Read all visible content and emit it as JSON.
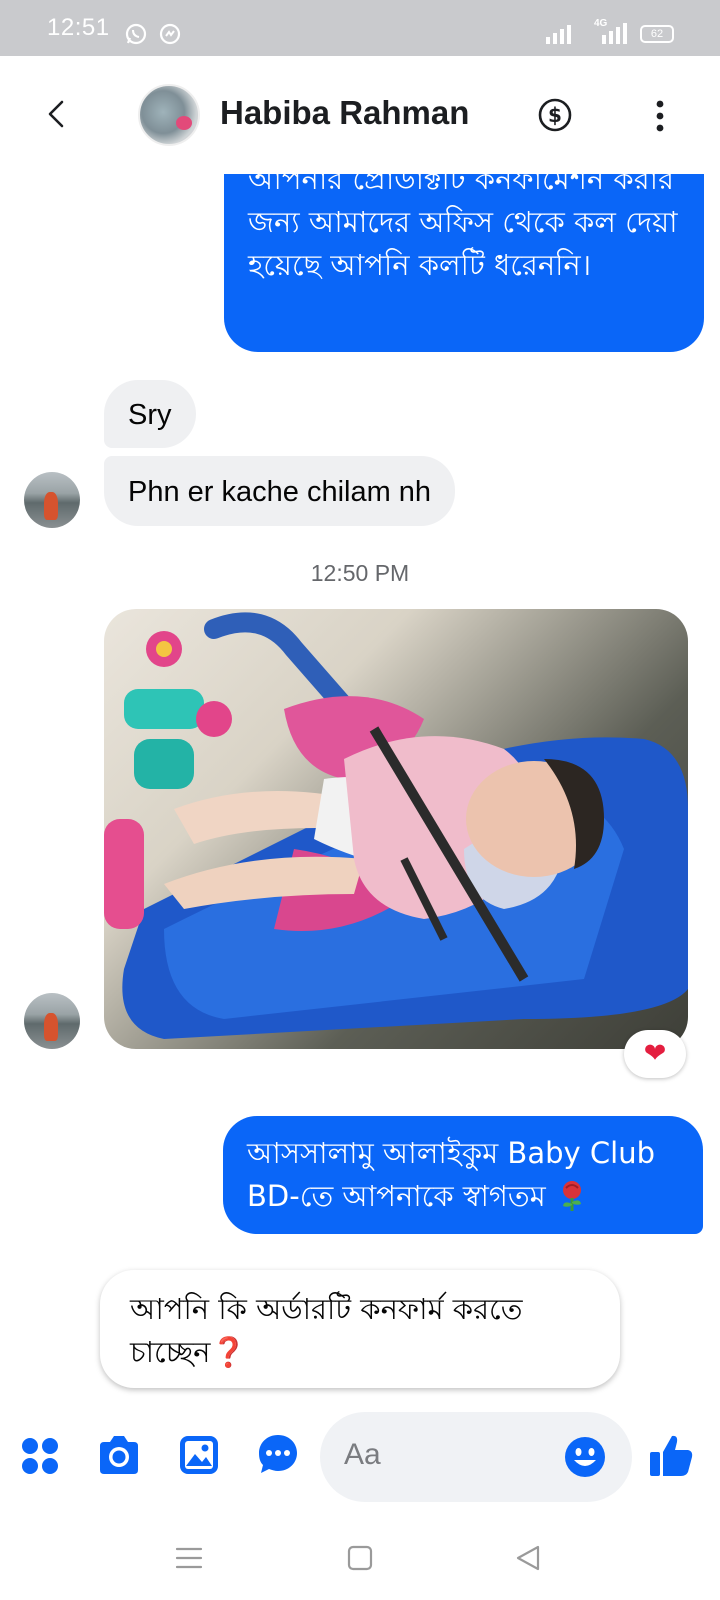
{
  "status_bar": {
    "time": "12:51",
    "network": "4G",
    "battery": "62"
  },
  "header": {
    "contact_name": "Habiba Rahman",
    "back_icon": "chevron-left-icon",
    "money_icon": "dollar-circle-icon",
    "more_icon": "vertical-ellipsis-icon"
  },
  "messages": {
    "outgoing_1": "আপনার প্রোডাক্টটি কনফার্মেশন করার জন্য আমাদের অফিস থেকে কল দেয়া হয়েছে আপনি কলটি ধরেননি।",
    "incoming_1": "Sry",
    "incoming_2": "Phn er kache chilam nh",
    "timestamp": "12:50 PM",
    "photo_reaction": "❤",
    "outgoing_2": "আসসালামু আলাইকুম Baby Club BD-তে আপনাকে স্বাগতম",
    "bot_prompt": "আপনি কি অর্ডারটি কনফার্ম করতে চাচ্ছেন",
    "bot_prompt_emoji": "❓"
  },
  "composer": {
    "placeholder": "Aa",
    "icons": [
      "apps-grid-icon",
      "camera-icon",
      "gallery-icon",
      "chat-bubble-icon",
      "emoji-icon",
      "thumbs-up-icon"
    ]
  },
  "colors": {
    "accent": "#0a66f8",
    "incoming_bubble": "#eff0f2",
    "status_bar": "#c9cacd"
  }
}
